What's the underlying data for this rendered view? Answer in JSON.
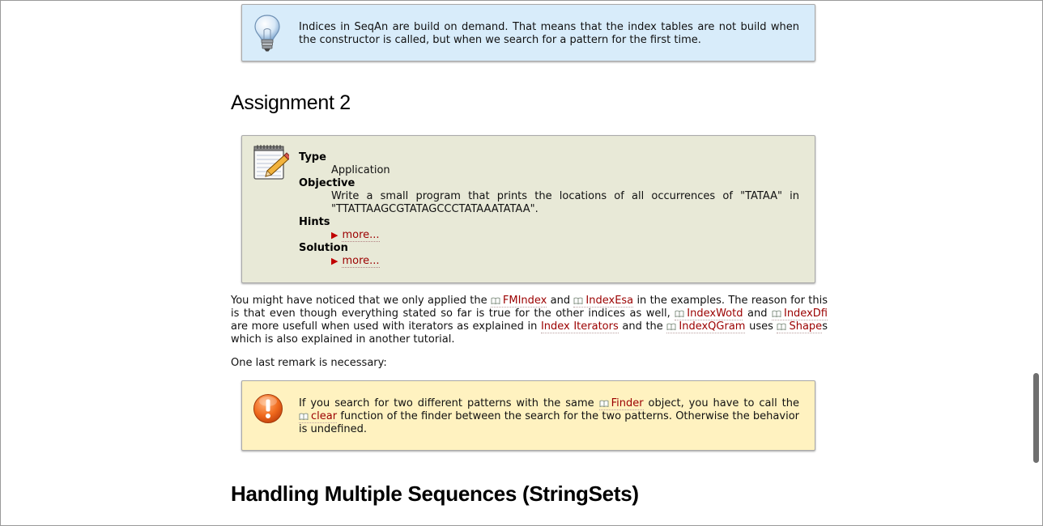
{
  "info_note": {
    "icon": "lightbulb-icon",
    "text": "Indices in SeqAn are build on demand. That means that the index tables are not build when the constructor is called, but when we search for a pattern for the first time."
  },
  "assignment": {
    "heading": "Assignment 2",
    "icon": "notepad-pencil-icon",
    "type_label": "Type",
    "type_value": "Application",
    "objective_label": "Objective",
    "objective_value": "Write a small program that prints the locations of all occurrences of \"TATAA\" in \"TTATTAAGCGTATAGCCCTATAAATATAA\".",
    "hints_label": "Hints",
    "hints_link": "more...",
    "solution_label": "Solution",
    "solution_link": "more..."
  },
  "paragraph1": {
    "t1": "You might have noticed that we only applied the ",
    "link_fmindex": "FMIndex",
    "t2": " and ",
    "link_indexesa": "IndexEsa",
    "t3": " in the examples. The reason for this is that even though everything stated so far is true for the other indices as well, ",
    "link_indexwotd": "IndexWotd",
    "t4": " and ",
    "link_indexdfi": "IndexDfi",
    "t5": " are more usefull when used with iterators as explained in ",
    "link_index_iterators": "Index Iterators",
    "t6": " and the ",
    "link_indexqgram": "IndexQGram",
    "t7": " uses ",
    "link_shape": "Shape",
    "t8": "s which is also explained in another tutorial."
  },
  "paragraph2": "One last remark is necessary:",
  "warning_note": {
    "icon": "warning-exclamation-icon",
    "t1": "If you search for two different patterns with the same ",
    "link_finder": "Finder",
    "t2": " object, you have to call the ",
    "link_clear": "clear",
    "t3": " function of the finder between the search for the two patterns. Otherwise the behavior is undefined."
  },
  "section_heading": "Handling Multiple Sequences (StringSets)",
  "colors": {
    "link": "#9b0000",
    "info_bg": "#d8ecfa",
    "assignment_bg": "#e8e9d7",
    "warning_bg": "#fff2c0"
  }
}
